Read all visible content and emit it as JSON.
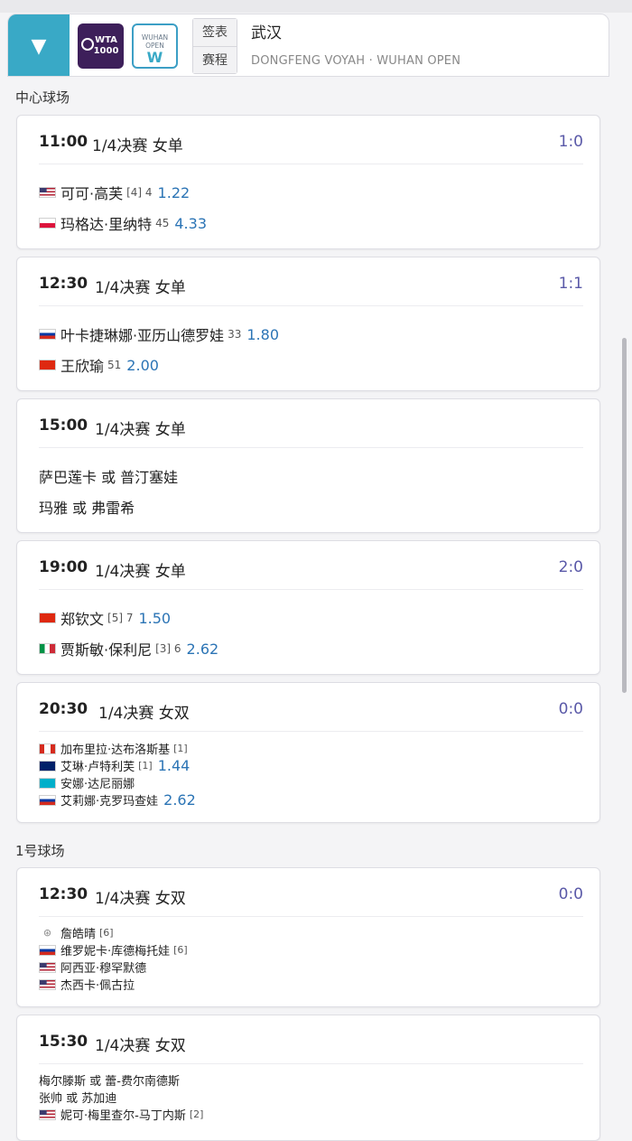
{
  "header": {
    "toggle_icon": "▼",
    "wta_logo_text": "WTA\n1000",
    "wuhan_logo_text": "WUHAN\nOPEN",
    "tabs": [
      "签表",
      "赛程"
    ],
    "tournament_name": "武汉",
    "tournament_subtitle": "DONGFENG VOYAH · WUHAN OPEN"
  },
  "courts": [
    {
      "name": "中心球场",
      "matches": [
        {
          "time": "11:00",
          "round": "1/4决赛 女单",
          "score": "1:0",
          "players": [
            {
              "flag": "us",
              "name": "可可·高芙",
              "seed": "[4] 4",
              "odds": "1.22"
            },
            {
              "flag": "pl",
              "name": "玛格达·里纳特",
              "seed": "45",
              "odds": "4.33"
            }
          ]
        },
        {
          "time": "12:30",
          "round": "1/4决赛 女单",
          "score": "1:1",
          "players": [
            {
              "flag": "ru",
              "name": "叶卡捷琳娜·亚历山德罗娃",
              "seed": "33",
              "odds": "1.80"
            },
            {
              "flag": "cn",
              "name": "王欣瑜",
              "seed": "51",
              "odds": "2.00"
            }
          ]
        },
        {
          "time": "15:00",
          "round": "1/4决赛 女单",
          "score": "",
          "players": [
            {
              "flag": "",
              "name": "萨巴莲卡 或 普汀塞娃",
              "seed": "",
              "odds": ""
            },
            {
              "flag": "",
              "name": "玛雅 或 弗雷希",
              "seed": "",
              "odds": ""
            }
          ]
        },
        {
          "time": "19:00",
          "round": "1/4决赛 女单",
          "score": "2:0",
          "players": [
            {
              "flag": "cn",
              "name": "郑钦文",
              "seed": "[5] 7",
              "odds": "1.50"
            },
            {
              "flag": "it",
              "name": "贾斯敏·保利尼",
              "seed": "[3] 6",
              "odds": "2.62"
            }
          ]
        },
        {
          "time": "20:30",
          "round": "1/4决赛 女双",
          "score": "0:0",
          "doubles": [
            {
              "flag": "ca",
              "name": "加布里拉·达布洛斯基",
              "seed": "[1]",
              "odds": ""
            },
            {
              "flag": "nz",
              "name": "艾琳·卢特利芙",
              "seed": "[1]",
              "odds": "1.44"
            },
            {
              "flag": "kz",
              "name": "安娜·达尼丽娜",
              "seed": "",
              "odds": ""
            },
            {
              "flag": "ru",
              "name": "艾莉娜·克罗玛查娃",
              "seed": "",
              "odds": "2.62"
            }
          ]
        }
      ]
    },
    {
      "name": "1号球场",
      "matches": [
        {
          "time": "12:30",
          "round": "1/4决赛 女双",
          "score": "0:0",
          "doubles": [
            {
              "flag": "tw",
              "name": "詹皓晴",
              "seed": "[6]",
              "odds": ""
            },
            {
              "flag": "ru",
              "name": "维罗妮卡·库德梅托娃",
              "seed": "[6]",
              "odds": ""
            },
            {
              "flag": "us",
              "name": "阿西亚·穆罕默德",
              "seed": "",
              "odds": ""
            },
            {
              "flag": "us",
              "name": "杰西卡·佩古拉",
              "seed": "",
              "odds": ""
            }
          ]
        },
        {
          "time": "15:30",
          "round": "1/4决赛 女双",
          "score": "",
          "doubles": [
            {
              "flag": "",
              "name": "梅尔滕斯 或 蕾-费尔南德斯",
              "seed": "",
              "odds": ""
            },
            {
              "flag": "",
              "name": "张帅 或 苏加迪",
              "seed": "",
              "odds": ""
            },
            {
              "flag": "us",
              "name": "妮可·梅里查尔-马丁内斯",
              "seed": "[2]",
              "odds": ""
            }
          ]
        }
      ]
    }
  ]
}
